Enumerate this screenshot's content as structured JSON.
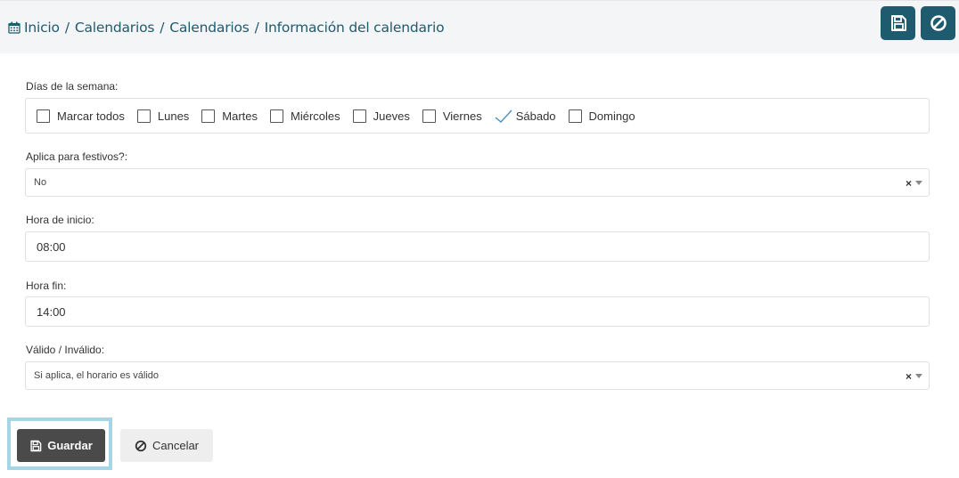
{
  "header": {
    "breadcrumb": [
      "Inicio",
      "Calendarios",
      "Calendarios",
      "Información del calendario"
    ],
    "separator": "/",
    "accent_color": "#1f5b6e",
    "actions": [
      {
        "icon": "floppy-disk-icon"
      },
      {
        "icon": "ban-icon"
      }
    ]
  },
  "form": {
    "days": {
      "label": "Días de la semana:",
      "options": [
        {
          "label": "Marcar todos",
          "checked": false
        },
        {
          "label": "Lunes",
          "checked": false
        },
        {
          "label": "Martes",
          "checked": false
        },
        {
          "label": "Miércoles",
          "checked": false
        },
        {
          "label": "Jueves",
          "checked": false
        },
        {
          "label": "Viernes",
          "checked": false
        },
        {
          "label": "Sábado",
          "checked": true
        },
        {
          "label": "Domingo",
          "checked": false
        }
      ]
    },
    "festivos": {
      "label": "Aplica para festivos?:",
      "value": "No"
    },
    "hora_inicio": {
      "label": "Hora de inicio:",
      "value": "08:00"
    },
    "hora_fin": {
      "label": "Hora fin:",
      "value": "14:00"
    },
    "valido": {
      "label": "Válido / Inválido:",
      "value": "Si aplica, el horario es válido"
    },
    "clear_symbol": "×"
  },
  "footer": {
    "save_label": "Guardar",
    "cancel_label": "Cancelar"
  }
}
